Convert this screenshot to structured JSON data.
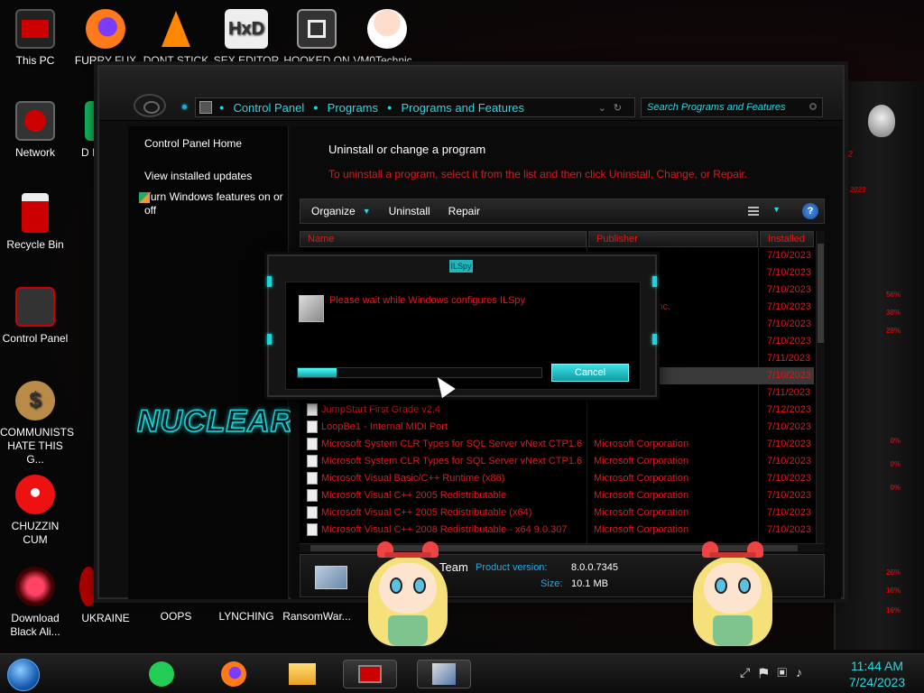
{
  "desktop": {
    "icons": [
      {
        "label": "This PC",
        "icon": "monitor-icon"
      },
      {
        "label": "FURRY FUX",
        "icon": "firefox-icon"
      },
      {
        "label": "DONT STICK",
        "icon": "vlc-cone-icon"
      },
      {
        "label": "SEX EDITOR",
        "icon": "hxd-icon"
      },
      {
        "label": "HOOKED ON",
        "icon": "game-tile-icon"
      },
      {
        "label": "VM0Technic...",
        "icon": "doctor-avatar-icon"
      },
      {
        "label": "Network",
        "icon": "network-icon"
      },
      {
        "label": "D I DUM",
        "icon": "green-app-icon"
      },
      {
        "label": "Recycle Bin",
        "icon": "recycle-bin-icon"
      },
      {
        "label": "Control Panel",
        "icon": "control-panel-icon"
      },
      {
        "label": "COMMUNISTS HATE THIS G...",
        "icon": "money-bag-icon"
      },
      {
        "label": "CHUZZIN CUM",
        "icon": "red-fuzzball-icon"
      },
      {
        "label": "Download Black Ali...",
        "icon": "alien-orb-icon"
      },
      {
        "label": "UKRAINE",
        "icon": "red-app-icon"
      },
      {
        "label": "OOPS",
        "icon": "blank-icon"
      },
      {
        "label": "LYNCHING",
        "icon": "blank-icon"
      },
      {
        "label": "RansomWar...",
        "icon": "blank-icon"
      }
    ]
  },
  "window": {
    "breadcrumb": [
      "Control Panel",
      "Programs",
      "Programs and Features"
    ],
    "search_placeholder": "Search Programs and Features",
    "left_pane": {
      "links": [
        "Control Panel Home",
        "View installed updates",
        "Turn Windows features on or off"
      ],
      "logo_text": "NUCLEAR"
    },
    "heading": "Uninstall or change a program",
    "description": "To uninstall a program, select it from the list and then click Uninstall, Change, or Repair.",
    "toolbar": {
      "organize": "Organize",
      "uninstall": "Uninstall",
      "repair": "Repair",
      "help": "?"
    },
    "columns": [
      "Name",
      "Publisher",
      "Installed"
    ],
    "rows": [
      {
        "name": "",
        "publisher": "",
        "date": "7/10/2023"
      },
      {
        "name": "",
        "publisher": "",
        "date": "7/10/2023"
      },
      {
        "name": "",
        "publisher": "",
        "date": "7/10/2023"
      },
      {
        "name": "",
        "publisher": "Technologies Inc.",
        "date": "7/10/2023"
      },
      {
        "name": "",
        "publisher": "",
        "date": "7/10/2023"
      },
      {
        "name": "",
        "publisher": "",
        "date": "7/10/2023"
      },
      {
        "name": "",
        "publisher": "",
        "date": "7/11/2023"
      },
      {
        "name": "",
        "publisher": "eam",
        "date": "7/10/2023",
        "selected": true
      },
      {
        "name": "",
        "publisher": "",
        "date": "7/11/2023"
      },
      {
        "name": "JumpStart First Grade v2.4",
        "publisher": "",
        "date": "7/12/2023"
      },
      {
        "name": "LoopBe1 - Internal MIDI Port",
        "publisher": "",
        "date": "7/10/2023"
      },
      {
        "name": "Microsoft System CLR Types for SQL Server vNext CTP1.6",
        "publisher": "Microsoft Corporation",
        "date": "7/10/2023"
      },
      {
        "name": "Microsoft System CLR Types for SQL Server vNext CTP1.6",
        "publisher": "Microsoft Corporation",
        "date": "7/10/2023"
      },
      {
        "name": "Microsoft Visual Basic/C++ Runtime (x86)",
        "publisher": "Microsoft Corporation",
        "date": "7/10/2023"
      },
      {
        "name": "Microsoft Visual C++ 2005 Redistributable",
        "publisher": "Microsoft Corporation",
        "date": "7/10/2023"
      },
      {
        "name": "Microsoft Visual C++ 2005 Redistributable (x64)",
        "publisher": "Microsoft Corporation",
        "date": "7/10/2023"
      },
      {
        "name": "Microsoft Visual C++ 2008 Redistributable - x64 9.0.307",
        "publisher": "Microsoft Corporation",
        "date": "7/10/2023"
      }
    ],
    "details": {
      "team": "Team",
      "product_version_label": "Product version:",
      "product_version": "8.0.0.7345",
      "size_label": "Size:",
      "size": "10.1 MB"
    }
  },
  "dialog": {
    "title": "ILSpy",
    "message": "Please wait while Windows configures ILSpy",
    "progress_fraction": 0.16,
    "cancel_label": "Cancel"
  },
  "taskbar": {
    "apps": [
      "notes-icon",
      "firefox-icon",
      "file-explorer-icon",
      "control-panel-icon",
      "programs-features-icon"
    ],
    "tray_icons": [
      "show-desktop-icon",
      "flag-icon",
      "network-icon",
      "volume-icon"
    ],
    "time": "11:44 AM",
    "date": "7/24/2023"
  },
  "colors": {
    "accent": "#29d8e0",
    "alert_red": "#e01a1a",
    "background": "#0b0b0d"
  }
}
